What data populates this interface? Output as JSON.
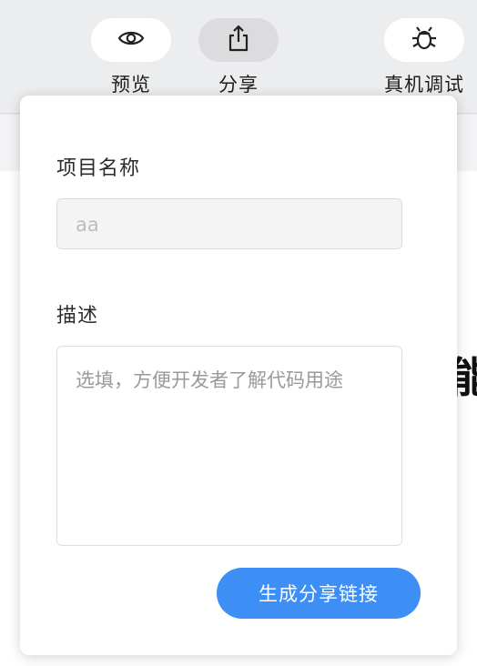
{
  "toolbar": {
    "items": [
      {
        "label": "预览",
        "icon": "eye-icon"
      },
      {
        "label": "分享",
        "icon": "share-icon",
        "active": true
      },
      {
        "label": "真机调试",
        "icon": "bug-icon"
      }
    ]
  },
  "background": {
    "partial_text": "能"
  },
  "share_popover": {
    "project_name_label": "项目名称",
    "project_name_value": "aa",
    "description_label": "描述",
    "description_placeholder": "选填，方便开发者了解代码用途",
    "generate_button_label": "生成分享链接"
  },
  "colors": {
    "accent": "#3d8ef5",
    "toolbar_bg": "#ecedef",
    "active_pill": "#dcdcdf"
  }
}
